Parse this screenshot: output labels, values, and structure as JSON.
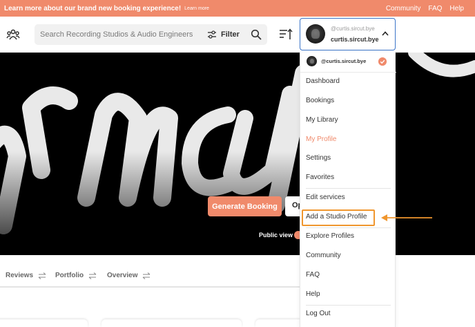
{
  "banner": {
    "text": "Learn more about our brand new booking experience!",
    "link": "Learn more",
    "nav": [
      "Community",
      "FAQ",
      "Help"
    ]
  },
  "header": {
    "search_placeholder": "Search Recording Studios & Audio Engineers",
    "filter_label": "Filter",
    "user": {
      "handle": "@curtis.sircut.bye",
      "name": "curtis.sircut.bye"
    }
  },
  "hero": {
    "generate_booking": "Generate Booking",
    "open_label": "Op",
    "public_view": "Public view"
  },
  "tabs": [
    "Reviews",
    "Portfolio",
    "Overview"
  ],
  "dropdown": {
    "handle": "@curtis.sircut.bye",
    "items": [
      "Dashboard",
      "Bookings",
      "My Library",
      "My Profile",
      "Settings",
      "Favorites",
      "Edit services",
      "Add a Studio Profile",
      "Explore Profiles",
      "Community",
      "FAQ",
      "Help",
      "Log Out"
    ],
    "active_item": "My Profile",
    "highlighted_item": "Add a Studio Profile"
  },
  "colors": {
    "accent": "#f08a6b",
    "focus_border": "#3a74c9",
    "annotation": "#f0962e"
  }
}
